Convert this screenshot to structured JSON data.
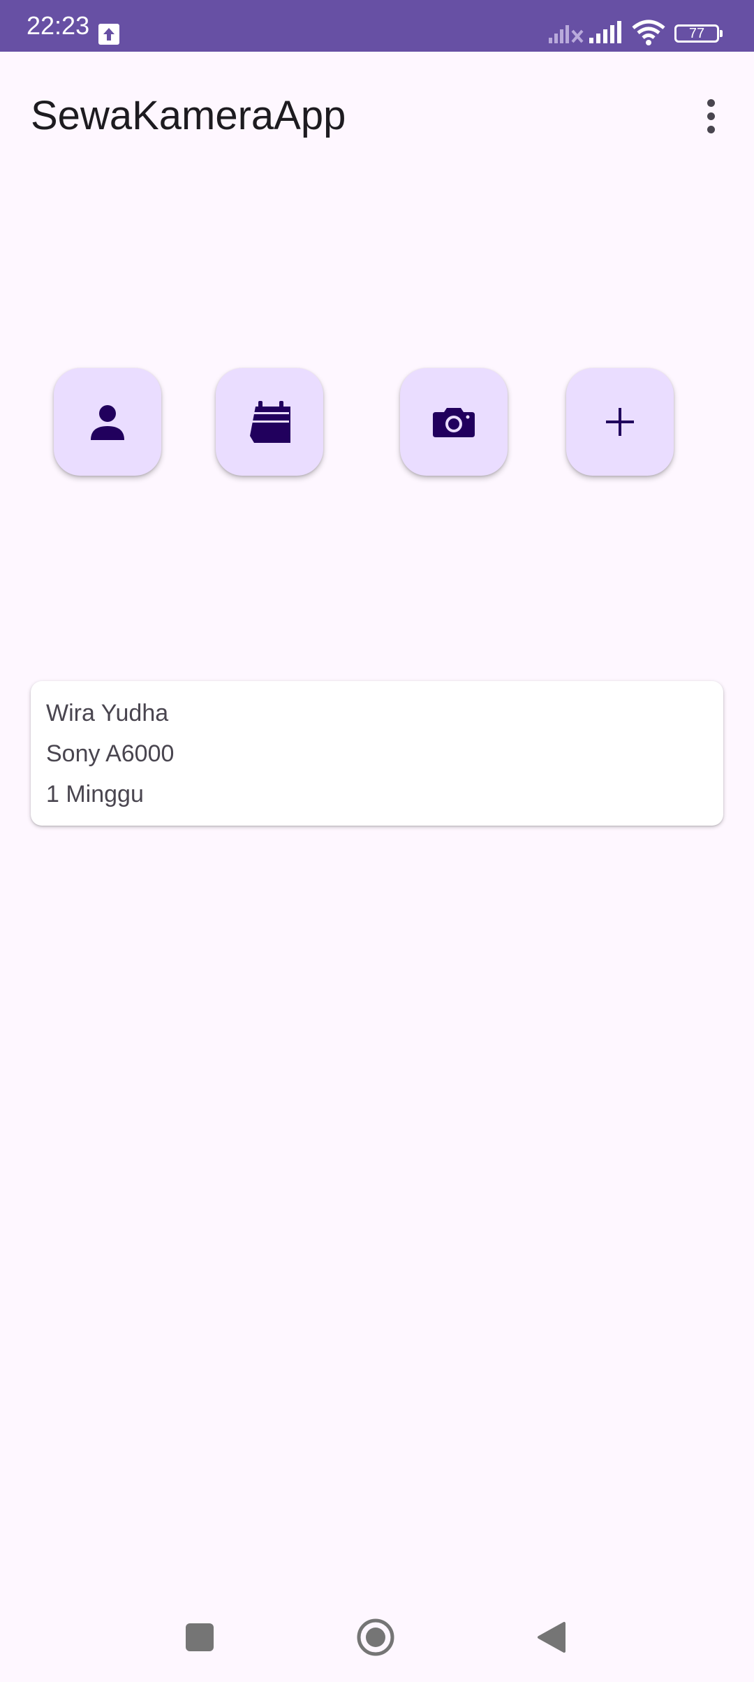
{
  "status_bar": {
    "time": "22:23",
    "battery": "77",
    "icons": [
      "upload-icon",
      "signal-no-sim-icon",
      "signal-icon",
      "wifi-icon",
      "battery-icon"
    ]
  },
  "app_bar": {
    "title": "SewaKameraApp",
    "menu_icon": "more-vert-icon"
  },
  "actions": [
    {
      "icon": "person-icon"
    },
    {
      "icon": "calendar-icon"
    },
    {
      "icon": "camera-icon"
    },
    {
      "icon": "add-icon"
    }
  ],
  "rental_card": {
    "renter_name": "Wira Yudha",
    "camera": "Sony A6000",
    "duration": "1 Minggu"
  },
  "nav_bar": {
    "icons": [
      "recent-apps-icon",
      "home-icon",
      "back-icon"
    ]
  },
  "colors": {
    "status_bar": "#6750A4",
    "background": "#FEF7FF",
    "button_container": "#EADDFF",
    "icon_on_container": "#21005D",
    "text_primary": "#1D1B20",
    "text_secondary": "#49454F"
  }
}
